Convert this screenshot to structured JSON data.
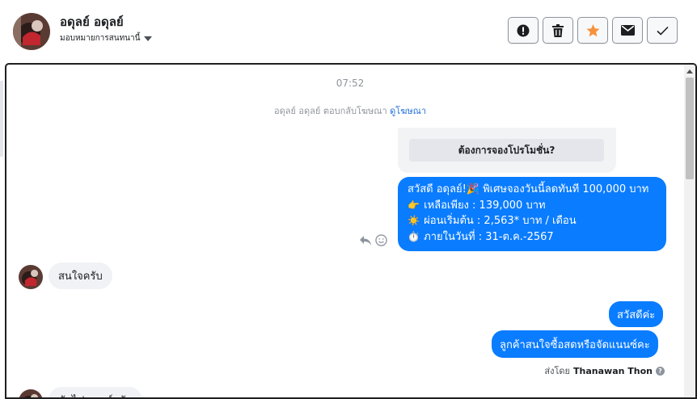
{
  "header": {
    "contact_name": "อดุลย์ อดุลย์",
    "assign_label": "มอบหมายการสนทนานี้",
    "actions": [
      {
        "name": "mark-spam-button",
        "icon": "alert-circle-icon"
      },
      {
        "name": "delete-button",
        "icon": "trash-icon"
      },
      {
        "name": "star-button",
        "icon": "star-icon",
        "color": "#f7923b"
      },
      {
        "name": "mark-unread-button",
        "icon": "envelope-icon"
      },
      {
        "name": "mark-done-button",
        "icon": "checkmark-icon"
      }
    ]
  },
  "conversation": {
    "timestamp": "07:52",
    "reply_note": {
      "text": "อดุลย์ อดุลย์ ตอบกลับโฆษณา",
      "link": "ดูโฆษณา"
    },
    "quick_reply": "ต้องการจองโปรโมชั่น?",
    "promo_lines": [
      {
        "emoji": "🎉",
        "text": "สวัสดี อดุลย์!🎉 พิเศษจองวันนี้ลดทันที 100,000 บาท"
      },
      {
        "emoji": "👉",
        "text": "เหลือเพียง : 139,000 บาท"
      },
      {
        "emoji": "☀️",
        "text": "ผ่อนเริ่มต้น : 2,563* บาท / เดือน"
      },
      {
        "emoji": "⏱️",
        "text": "ภายในวันที่ : 31-ต.ค.-2567"
      }
    ],
    "incoming_1": "สนใจครับ",
    "outgoing_2": "สวัสดีค่ะ",
    "outgoing_3": "ลูกค้าสนใจซื้อสดหรือจัดแนนซ์คะ",
    "sent_by_prefix": "ส่งโดย",
    "sent_by_name": "Thanawan Thon",
    "incoming_2": "ตัดไฟแนนซ์ครับ"
  },
  "colors": {
    "accent": "#0a7cff",
    "incoming_bubble": "#f0f2f5",
    "link": "#216fdb"
  }
}
